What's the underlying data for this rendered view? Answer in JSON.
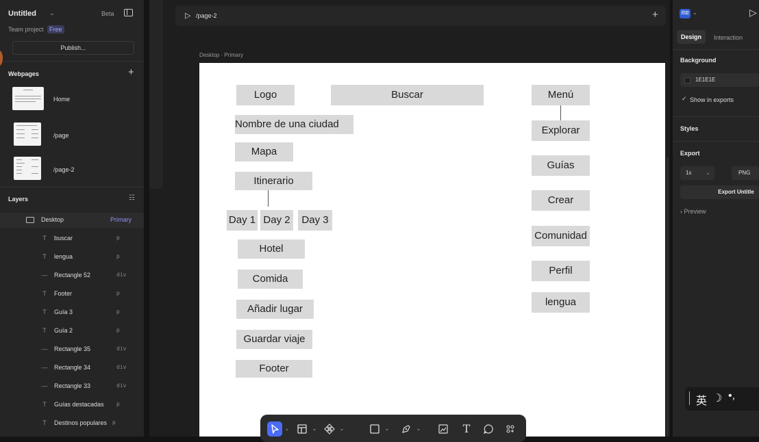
{
  "left_panel": {
    "project_title": "Untitled",
    "beta_label": "Beta",
    "team_label": "Team project",
    "plan_badge": "Free",
    "publish_label": "Publish...",
    "webpages_title": "Webpages",
    "add_symbol": "+",
    "pages": [
      {
        "label": "Home"
      },
      {
        "label": "/page"
      },
      {
        "label": "/page-2"
      }
    ],
    "layers_title": "Layers",
    "root_layer": {
      "label": "Desktop",
      "tag": "Primary"
    },
    "layers": [
      {
        "icon": "T",
        "label": "buscar",
        "tag": "p"
      },
      {
        "icon": "T",
        "label": "lengua",
        "tag": "p"
      },
      {
        "icon": "—",
        "label": "Rectangle 52",
        "tag": "div"
      },
      {
        "icon": "T",
        "label": "Footer",
        "tag": "p"
      },
      {
        "icon": "T",
        "label": "Guía 3",
        "tag": "p"
      },
      {
        "icon": "T",
        "label": "Guía 2",
        "tag": "p"
      },
      {
        "icon": "—",
        "label": "Rectangle 35",
        "tag": "div"
      },
      {
        "icon": "—",
        "label": "Rectangle 34",
        "tag": "div"
      },
      {
        "icon": "—",
        "label": "Rectangle 33",
        "tag": "div"
      },
      {
        "icon": "T",
        "label": "Guías destacadas",
        "tag": "p"
      },
      {
        "icon": "T",
        "label": "Destinos populares",
        "tag": "p"
      }
    ]
  },
  "canvas": {
    "page_path": "/page-2",
    "add_symbol": "+",
    "frame_label": "Desktop · Primary",
    "wireframe": {
      "logo": "Logo",
      "buscar": "Buscar",
      "menu": "Menú",
      "ciudad": "Nombre de una ciudad",
      "mapa": "Mapa",
      "itinerario": "Itinerario",
      "day1": "Day 1",
      "day2": "Day 2",
      "day3": "Day 3",
      "hotel": "Hotel",
      "comida": "Comida",
      "anadir": "Añadir lugar",
      "guardar": "Guardar viaje",
      "footer": "Footer",
      "explorar": "Explorar",
      "guias": "Guías",
      "crear": "Crear",
      "comunidad": "Comunidad",
      "perfil": "Perfil",
      "lengua": "lengua"
    }
  },
  "toolbar": {
    "text_tool": "T",
    "dropdown_symbol": "⌄"
  },
  "right_panel": {
    "avatar_text": "郑歆",
    "tabs": {
      "design": "Design",
      "interaction": "Interaction"
    },
    "background_title": "Background",
    "background_color": "1E1E1E",
    "show_in_exports": "Show in exports",
    "styles_title": "Styles",
    "export_title": "Export",
    "export_scale": "1x",
    "export_format": "PNG",
    "export_button": "Export Untitle",
    "preview_label": "Preview",
    "ime_text": "英"
  },
  "colors": {
    "accent": "#4a6cf7",
    "panel": "#252525",
    "canvas": "#1e1e1e",
    "wire_box": "#d9d9d9"
  }
}
